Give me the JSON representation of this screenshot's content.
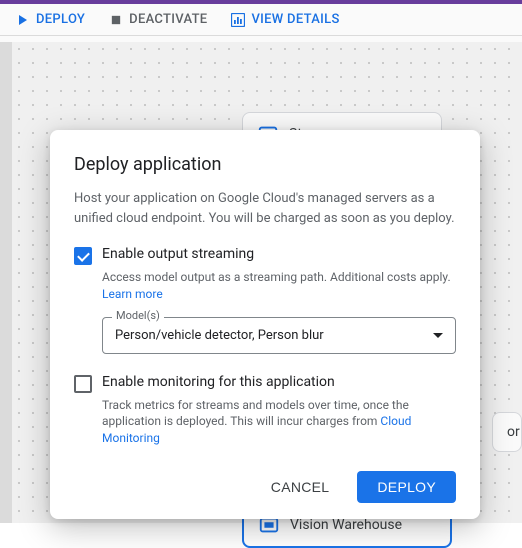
{
  "toolbar": {
    "deploy": "DEPLOY",
    "deactivate": "DEACTIVATE",
    "view_details": "VIEW DETAILS"
  },
  "canvas": {
    "nodes": {
      "streams": "Streams",
      "vision_warehouse": "Vision Warehouse",
      "partial_right": "or"
    }
  },
  "dialog": {
    "title": "Deploy application",
    "description": "Host your application on Google Cloud's managed servers as a unified cloud endpoint. You will be charged as soon as you deploy.",
    "streaming": {
      "checked": true,
      "label": "Enable output streaming",
      "sub": "Access model output as a streaming path. Additional costs apply. ",
      "learn_more": "Learn more"
    },
    "models": {
      "label": "Model(s)",
      "value": "Person/vehicle detector, Person blur"
    },
    "monitoring": {
      "checked": false,
      "label": "Enable monitoring for this application",
      "sub_pre": "Track metrics for streams and models over time, once the application is deployed. This will incur charges from ",
      "link": "Cloud Monitoring"
    },
    "actions": {
      "cancel": "CANCEL",
      "deploy": "DEPLOY"
    }
  },
  "colors": {
    "primary": "#1a73e8",
    "purple": "#6b3fa0"
  }
}
